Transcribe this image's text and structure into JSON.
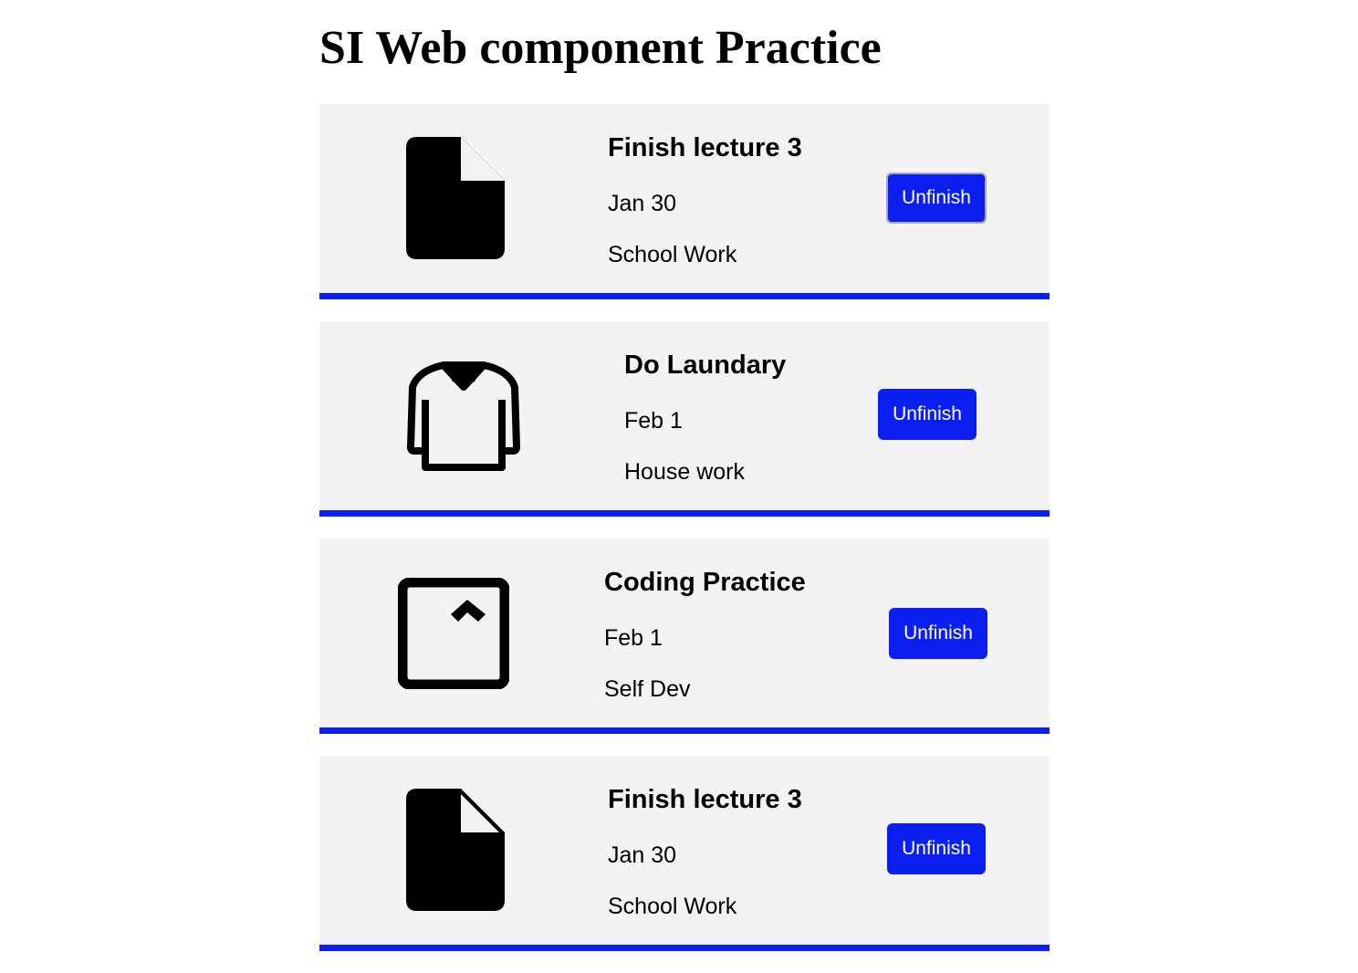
{
  "page": {
    "title": "SI Web component Practice"
  },
  "colors": {
    "accent": "#0a1ff0",
    "card_bg": "#f3f3f3"
  },
  "tasks": [
    {
      "icon": "document-icon",
      "title": "Finish lecture 3",
      "date": "Jan 30",
      "category": "School Work",
      "button_label": "Unfinish"
    },
    {
      "icon": "shirt-icon",
      "title": "Do Laundary",
      "date": "Feb 1",
      "category": "House work",
      "button_label": "Unfinish"
    },
    {
      "icon": "window-expand-icon",
      "title": "Coding Practice",
      "date": "Feb 1",
      "category": "Self Dev",
      "button_label": "Unfinish"
    },
    {
      "icon": "document-icon",
      "title": "Finish lecture 3",
      "date": "Jan 30",
      "category": "School Work",
      "button_label": "Unfinish"
    }
  ]
}
